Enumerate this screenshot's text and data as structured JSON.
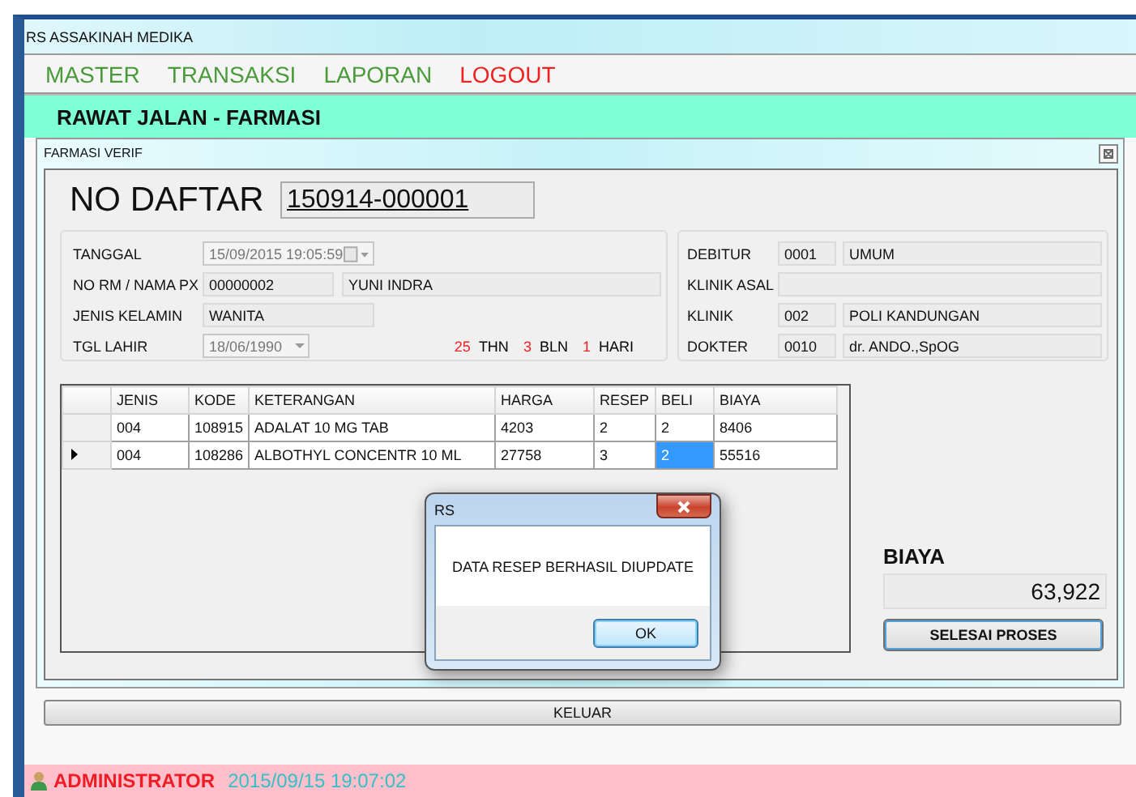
{
  "app": {
    "title": "RS ASSAKINAH MEDIKA"
  },
  "menu": [
    {
      "label": "MASTER",
      "color": "#4a9a3a"
    },
    {
      "label": "TRANSAKSI",
      "color": "#4a9a3a"
    },
    {
      "label": "LAPORAN",
      "color": "#4a9a3a"
    },
    {
      "label": "LOGOUT",
      "color": "#ee2222"
    }
  ],
  "module_title": "RAWAT JALAN - FARMASI",
  "form": {
    "title": "FARMASI VERIF",
    "no_daftar": {
      "label": "NO DAFTAR",
      "value": "150914-000001"
    },
    "patient": {
      "tanggal": {
        "label": "TANGGAL",
        "value": "15/09/2015 19:05:59",
        "disabled": true
      },
      "no_rm": {
        "label": "NO RM / NAMA PX",
        "value": "00000002",
        "name": "YUNI INDRA"
      },
      "jenis_kelamin": {
        "label": "JENIS KELAMIN",
        "value": "WANITA"
      },
      "tgl_lahir": {
        "label": "TGL LAHIR",
        "value": "18/06/1990",
        "disabled": true
      },
      "age": [
        {
          "value": "25",
          "unit": "THN"
        },
        {
          "value": "3",
          "unit": "BLN"
        },
        {
          "value": "1",
          "unit": "HARI"
        }
      ]
    },
    "billing": [
      {
        "label": "DEBITUR",
        "code": "0001",
        "name": "UMUM"
      },
      {
        "label": "KLINIK ASAL"
      },
      {
        "label": "KLINIK",
        "code": "002",
        "name": "POLI KANDUNGAN"
      },
      {
        "label": "DOKTER",
        "code": "0010",
        "name": "dr. ANDO.,SpOG"
      }
    ],
    "table": {
      "columns": [
        "JENIS",
        "KODE",
        "KETERANGAN",
        "HARGA",
        "RESEP",
        "BELI",
        "BIAYA"
      ],
      "rows": [
        {
          "current": false,
          "cells": [
            {
              "text": "004",
              "selected": false
            },
            {
              "text": "108915",
              "selected": false
            },
            {
              "text": "ADALAT 10 MG TAB",
              "selected": false
            },
            {
              "text": "4203",
              "selected": false
            },
            {
              "text": "2",
              "selected": false
            },
            {
              "text": "2",
              "selected": false
            },
            {
              "text": "8406",
              "selected": false
            }
          ]
        },
        {
          "current": true,
          "cells": [
            {
              "text": "004",
              "selected": false
            },
            {
              "text": "108286",
              "selected": false
            },
            {
              "text": "ALBOTHYL CONCENTR 10 ML",
              "selected": false
            },
            {
              "text": "27758",
              "selected": false
            },
            {
              "text": "3",
              "selected": false
            },
            {
              "text": "2",
              "selected": true
            },
            {
              "text": "55516",
              "selected": false
            }
          ]
        }
      ]
    },
    "total": {
      "label": "BIAYA",
      "value": "63,922"
    },
    "finish_button": "SELESAI PROSES"
  },
  "exit_button": "KELUAR",
  "dialog": {
    "title": "RS",
    "message": "DATA RESEP BERHASIL DIUPDATE",
    "button": "OK"
  },
  "status_bar": {
    "user": "ADMINISTRATOR",
    "datetime": "2015/09/15 19:07:02"
  }
}
